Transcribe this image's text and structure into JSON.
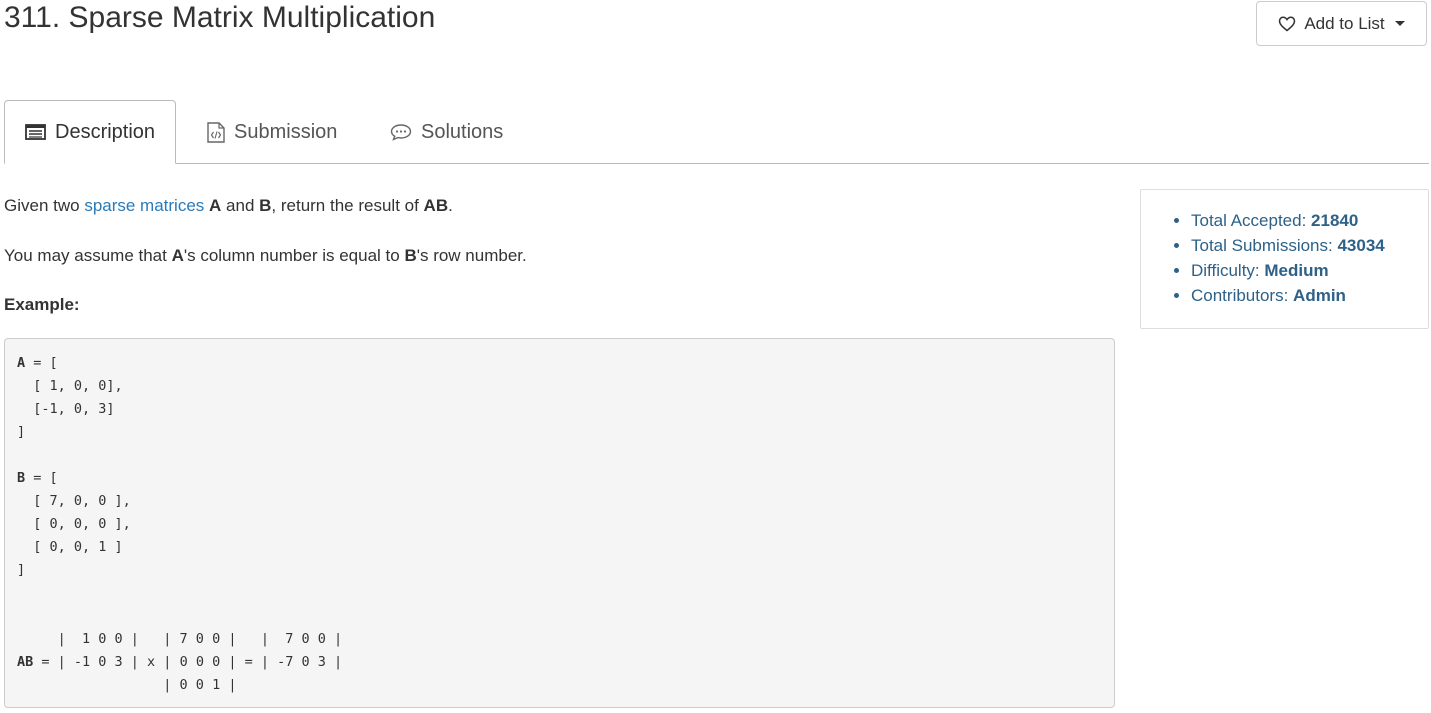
{
  "header": {
    "title": "311. Sparse Matrix Multiplication",
    "add_to_list_label": "Add to List"
  },
  "tabs": [
    {
      "label": "Description",
      "icon": "description-icon",
      "active": true
    },
    {
      "label": "Submission",
      "icon": "submission-code-icon",
      "active": false
    },
    {
      "label": "Solutions",
      "icon": "chat-bubble-icon",
      "active": false
    }
  ],
  "description": {
    "p1": {
      "t1": "Given two ",
      "link": "sparse matrices",
      "t2": " ",
      "b1": "A",
      "t3": " and ",
      "b2": "B",
      "t4": ", return the result of ",
      "b3": "AB",
      "t5": "."
    },
    "p2": {
      "t1": "You may assume that ",
      "b1": "A",
      "t2": "'s column number is equal to ",
      "b2": "B",
      "t3": "'s row number."
    },
    "example_label": "Example:"
  },
  "code": {
    "a_label": "A",
    "a_rest": " = [\n  [ 1, 0, 0],\n  [-1, 0, 3]\n]\n\n",
    "b_label": "B",
    "b_rest": " = [\n  [ 7, 0, 0 ],\n  [ 0, 0, 0 ],\n  [ 0, 0, 1 ]\n]\n\n\n     |  1 0 0 |   | 7 0 0 |   |  7 0 0 |\n",
    "ab_label": "AB",
    "ab_rest": " = | -1 0 3 | x | 0 0 0 | = | -7 0 3 |\n                  | 0 0 1 |"
  },
  "stats": {
    "accepted_label": "Total Accepted: ",
    "accepted_value": "21840",
    "submissions_label": "Total Submissions: ",
    "submissions_value": "43034",
    "difficulty_label": "Difficulty: ",
    "difficulty_value": "Medium",
    "contributors_label": "Contributors: ",
    "contributors_value": "Admin"
  },
  "colors": {
    "link": "#2a7ab8",
    "stats_text": "#2d6188",
    "code_bg": "#f5f5f5"
  }
}
